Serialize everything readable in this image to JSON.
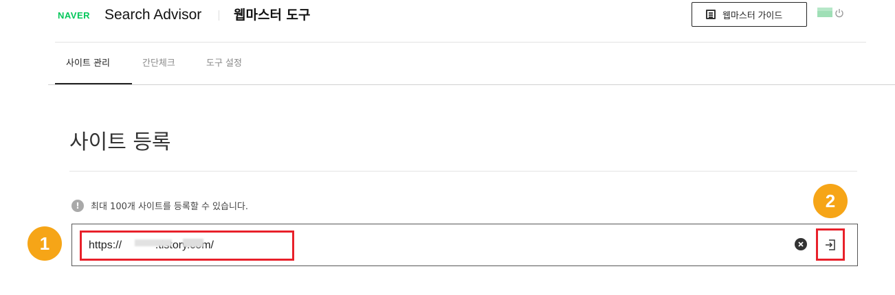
{
  "header": {
    "brand": "NAVER",
    "product": "Search Advisor",
    "subtitle": "웹마스터 도구",
    "guide_button": "웹마스터 가이드"
  },
  "tabs": [
    {
      "label": "사이트 관리",
      "active": true
    },
    {
      "label": "간단체크",
      "active": false
    },
    {
      "label": "도구 설정",
      "active": false
    }
  ],
  "main": {
    "title": "사이트 등록",
    "notice": "최대 100개 사이트를 등록할 수 있습니다.",
    "notice_icon": "!",
    "url_value": "https://           .tistory.com/"
  },
  "annotations": {
    "badge_1": "1",
    "badge_2": "2"
  },
  "colors": {
    "accent_green": "#03c75a",
    "highlight_red": "#e8202a",
    "badge_orange": "#f6a517"
  }
}
